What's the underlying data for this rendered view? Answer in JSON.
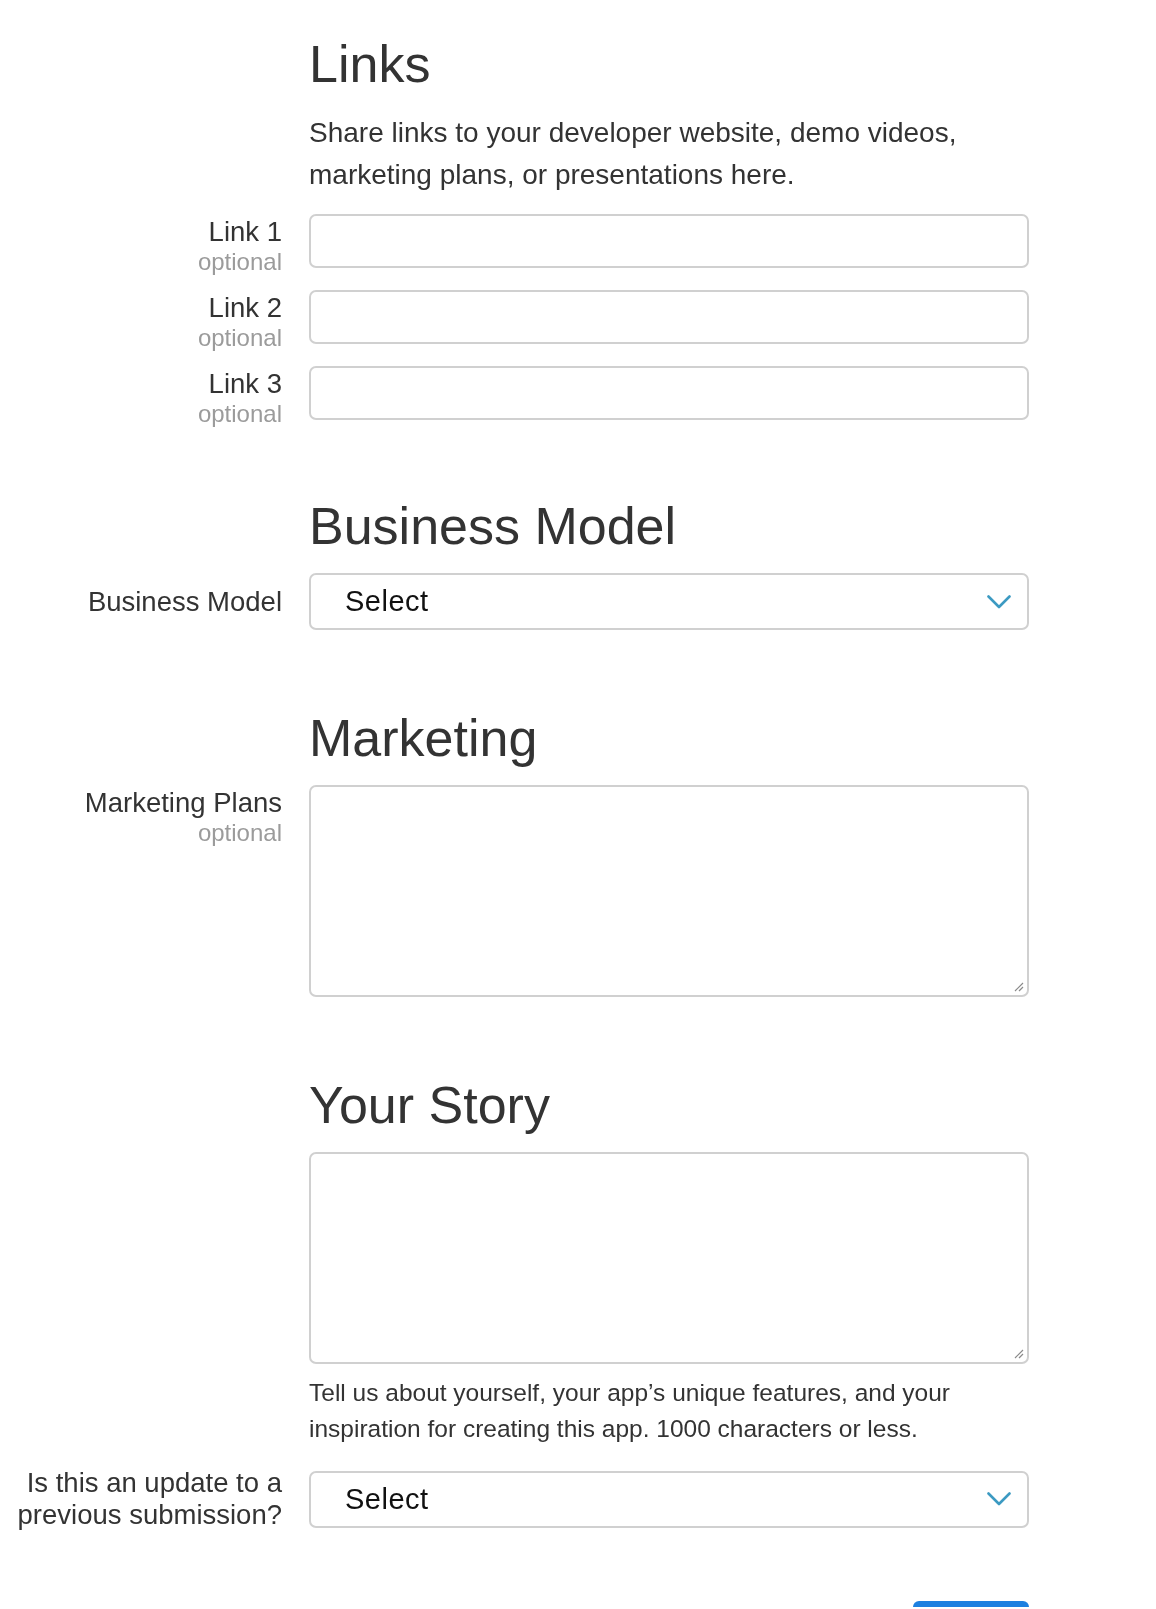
{
  "sections": [
    {
      "heading": "Links",
      "description": "Share links to your developer website, demo videos, marketing plans, or presentations here.",
      "fields": [
        {
          "kind": "text",
          "label": "Link 1",
          "note": "optional"
        },
        {
          "kind": "text",
          "label": "Link 2",
          "note": "optional"
        },
        {
          "kind": "text",
          "label": "Link 3",
          "note": "optional"
        }
      ]
    },
    {
      "heading": "Business Model",
      "fields": [
        {
          "kind": "select",
          "label": "Business Model",
          "value": "Select"
        }
      ]
    },
    {
      "heading": "Marketing",
      "fields": [
        {
          "kind": "textarea",
          "label": "Marketing Plans",
          "note": "optional"
        }
      ]
    },
    {
      "heading": "Your Story",
      "fields": [
        {
          "kind": "textarea",
          "help": "Tell us about yourself, your app’s unique features, and your inspiration for creating this app. 1000 characters or less."
        },
        {
          "kind": "select",
          "label": "Is this an update to a previous submission?",
          "value": "Select"
        }
      ]
    }
  ],
  "buttons": [
    {
      "kind": "primary"
    }
  ]
}
